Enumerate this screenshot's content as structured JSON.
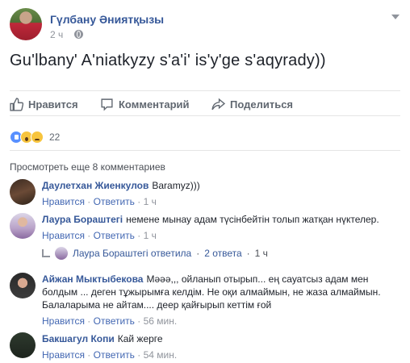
{
  "post": {
    "author": "Гүлбану Әниятқызы",
    "time": "2 ч",
    "text": "Gu'lbany' A'niatkyzy s'a'i' is'y'ge s'aqyrady))"
  },
  "actions": {
    "like": "Нравится",
    "comment": "Комментарий",
    "share": "Поделиться"
  },
  "reactions": {
    "count": "22",
    "types": [
      "like-icon",
      "wow-icon",
      "sad-icon"
    ]
  },
  "more_comments": "Просмотреть еще 8 комментариев",
  "comments": [
    {
      "name": "Даулетхан Жиенкулов",
      "text": "Baramyz)))",
      "like": "Нравится",
      "reply": "Ответить",
      "time": "1 ч"
    },
    {
      "name": "Лаура Бораштегі",
      "text": "немене мынау адам түсінбейтін толып жатқан нүктелер.",
      "like": "Нравится",
      "reply": "Ответить",
      "time": "1 ч"
    },
    {
      "name": "Айжан Мыктыбекова",
      "text": "Мәәә,,, ойланып отырып... ең сауатсыз адам мен болдым ... деген тұжырымға келдім. Не оқи алмаймын, не жаза алмаймын. Балаларыма не айтам.... деep қайғырып кеттім ғой",
      "like": "Нравится",
      "reply": "Ответить",
      "time": "56 мин."
    },
    {
      "name": "Бакшагул Копи",
      "text": "Кай жерге",
      "like": "Нравится",
      "reply": "Ответить",
      "time": "54 мин."
    }
  ],
  "reply_thread": {
    "author": "Лаура Бораштегі ответила",
    "count": "2 ответа",
    "time": "1 ч"
  },
  "colors": {
    "link": "#365899",
    "meta": "#90949c",
    "text": "#1d2129"
  }
}
